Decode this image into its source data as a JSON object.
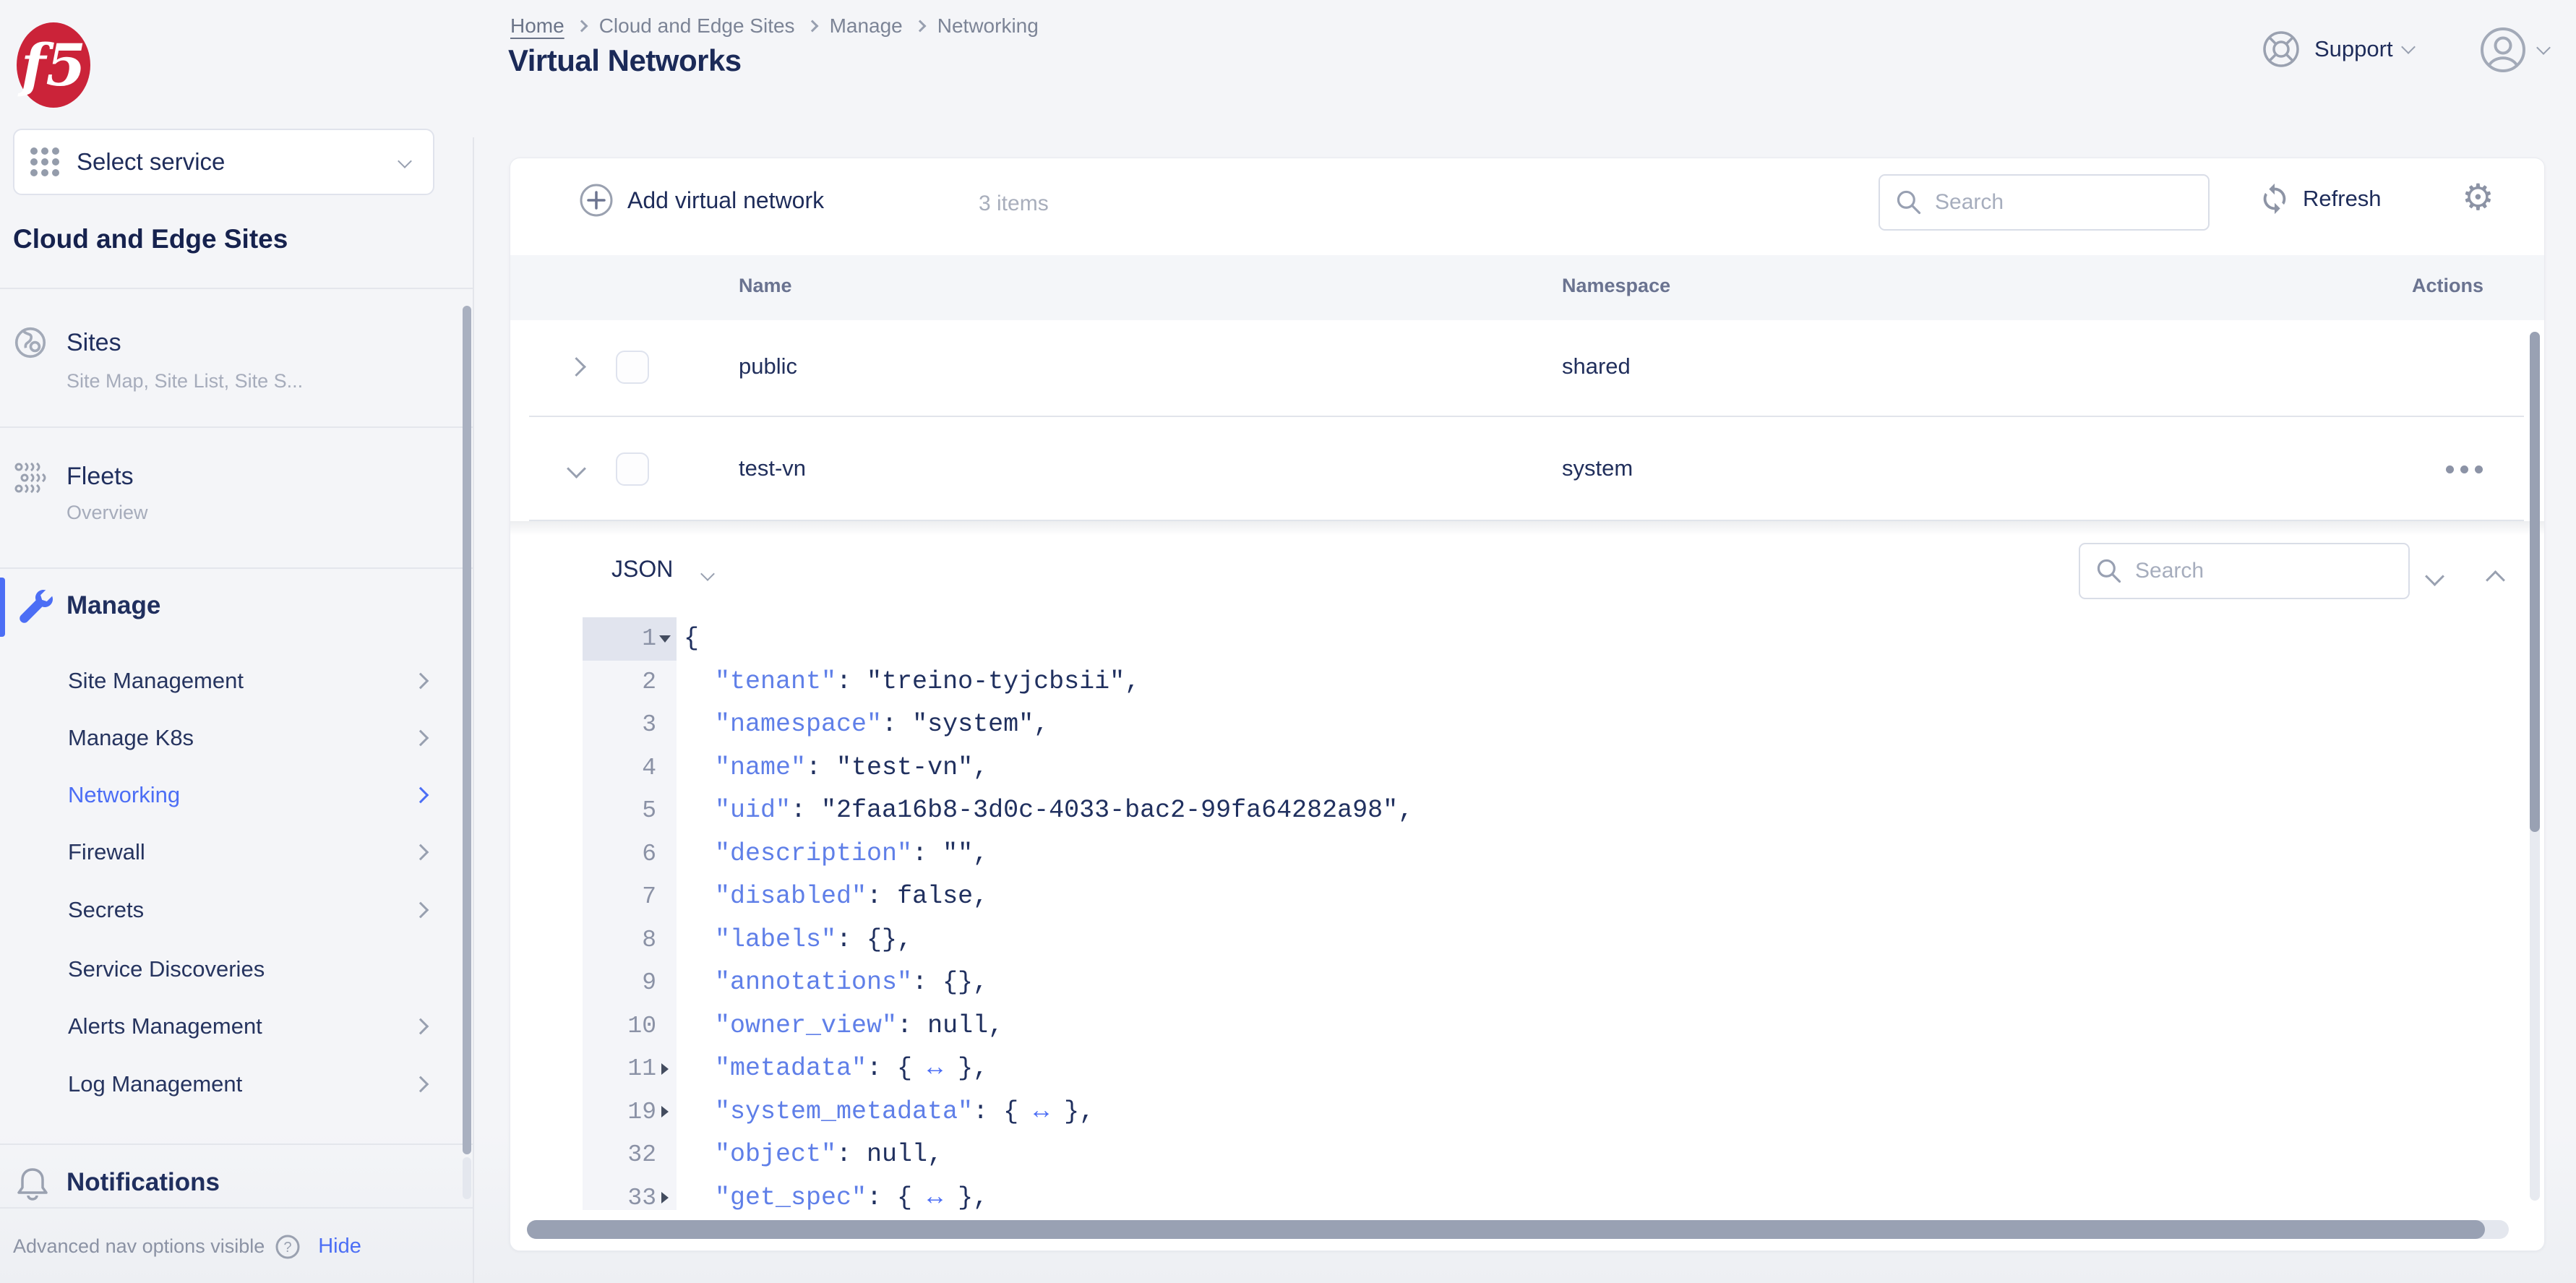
{
  "sidebar": {
    "logo_text": "f5",
    "select_service": "Select service",
    "heading": "Cloud and Edge Sites",
    "sites": {
      "title": "Sites",
      "subtitle": "Site Map, Site List, Site S..."
    },
    "fleets": {
      "title": "Fleets",
      "subtitle": "Overview"
    },
    "manage": {
      "title": "Manage",
      "items": [
        {
          "label": "Site Management",
          "chevron": true,
          "active": false
        },
        {
          "label": "Manage K8s",
          "chevron": true,
          "active": false
        },
        {
          "label": "Networking",
          "chevron": true,
          "active": true
        },
        {
          "label": "Firewall",
          "chevron": true,
          "active": false
        },
        {
          "label": "Secrets",
          "chevron": true,
          "active": false
        },
        {
          "label": "Service Discoveries",
          "chevron": false,
          "active": false
        },
        {
          "label": "Alerts Management",
          "chevron": true,
          "active": false
        },
        {
          "label": "Log Management",
          "chevron": true,
          "active": false
        }
      ]
    },
    "notifications": {
      "title": "Notifications"
    },
    "footer": {
      "text": "Advanced nav options visible",
      "action": "Hide"
    }
  },
  "header": {
    "breadcrumb": [
      {
        "label": "Home"
      },
      {
        "label": "Cloud and Edge Sites"
      },
      {
        "label": "Manage"
      },
      {
        "label": "Networking"
      }
    ],
    "title": "Virtual Networks",
    "support_label": "Support"
  },
  "toolbar": {
    "add_label": "Add virtual network",
    "items_count": "3 items",
    "search_placeholder": "Search",
    "refresh_label": "Refresh"
  },
  "table": {
    "columns": [
      "Name",
      "Namespace",
      "Actions"
    ],
    "rows": [
      {
        "name": "public",
        "namespace": "shared",
        "expanded": false,
        "has_actions": false
      },
      {
        "name": "test-vn",
        "namespace": "system",
        "expanded": true,
        "has_actions": true
      }
    ]
  },
  "json_viewer": {
    "mode": "JSON",
    "search_placeholder": "Search",
    "lines": [
      {
        "num": "1",
        "ind": 0,
        "fold": "open",
        "tokens": [
          {
            "t": "p",
            "v": "{"
          }
        ]
      },
      {
        "num": "2",
        "ind": 1,
        "fold": null,
        "tokens": [
          {
            "t": "k",
            "v": "\"tenant\""
          },
          {
            "t": "p",
            "v": ": "
          },
          {
            "t": "v",
            "v": "\"treino-tyjcbsii\""
          },
          {
            "t": "p",
            "v": ","
          }
        ]
      },
      {
        "num": "3",
        "ind": 1,
        "fold": null,
        "tokens": [
          {
            "t": "k",
            "v": "\"namespace\""
          },
          {
            "t": "p",
            "v": ": "
          },
          {
            "t": "v",
            "v": "\"system\""
          },
          {
            "t": "p",
            "v": ","
          }
        ]
      },
      {
        "num": "4",
        "ind": 1,
        "fold": null,
        "tokens": [
          {
            "t": "k",
            "v": "\"name\""
          },
          {
            "t": "p",
            "v": ": "
          },
          {
            "t": "v",
            "v": "\"test-vn\""
          },
          {
            "t": "p",
            "v": ","
          }
        ]
      },
      {
        "num": "5",
        "ind": 1,
        "fold": null,
        "tokens": [
          {
            "t": "k",
            "v": "\"uid\""
          },
          {
            "t": "p",
            "v": ": "
          },
          {
            "t": "v",
            "v": "\"2faa16b8-3d0c-4033-bac2-99fa64282a98\""
          },
          {
            "t": "p",
            "v": ","
          }
        ]
      },
      {
        "num": "6",
        "ind": 1,
        "fold": null,
        "tokens": [
          {
            "t": "k",
            "v": "\"description\""
          },
          {
            "t": "p",
            "v": ": "
          },
          {
            "t": "v",
            "v": "\"\""
          },
          {
            "t": "p",
            "v": ","
          }
        ]
      },
      {
        "num": "7",
        "ind": 1,
        "fold": null,
        "tokens": [
          {
            "t": "k",
            "v": "\"disabled\""
          },
          {
            "t": "p",
            "v": ": "
          },
          {
            "t": "v",
            "v": "false"
          },
          {
            "t": "p",
            "v": ","
          }
        ]
      },
      {
        "num": "8",
        "ind": 1,
        "fold": null,
        "tokens": [
          {
            "t": "k",
            "v": "\"labels\""
          },
          {
            "t": "p",
            "v": ": {},"
          }
        ]
      },
      {
        "num": "9",
        "ind": 1,
        "fold": null,
        "tokens": [
          {
            "t": "k",
            "v": "\"annotations\""
          },
          {
            "t": "p",
            "v": ": {},"
          }
        ]
      },
      {
        "num": "10",
        "ind": 1,
        "fold": null,
        "tokens": [
          {
            "t": "k",
            "v": "\"owner_view\""
          },
          {
            "t": "p",
            "v": ": "
          },
          {
            "t": "v",
            "v": "null"
          },
          {
            "t": "p",
            "v": ","
          }
        ]
      },
      {
        "num": "11",
        "ind": 1,
        "fold": "closed",
        "tokens": [
          {
            "t": "k",
            "v": "\"metadata\""
          },
          {
            "t": "p",
            "v": ": { "
          },
          {
            "t": "a",
            "v": "↔"
          },
          {
            "t": "p",
            "v": " },"
          }
        ]
      },
      {
        "num": "19",
        "ind": 1,
        "fold": "closed",
        "tokens": [
          {
            "t": "k",
            "v": "\"system_metadata\""
          },
          {
            "t": "p",
            "v": ": { "
          },
          {
            "t": "a",
            "v": "↔"
          },
          {
            "t": "p",
            "v": " },"
          }
        ]
      },
      {
        "num": "32",
        "ind": 1,
        "fold": null,
        "tokens": [
          {
            "t": "k",
            "v": "\"object\""
          },
          {
            "t": "p",
            "v": ": "
          },
          {
            "t": "v",
            "v": "null"
          },
          {
            "t": "p",
            "v": ","
          }
        ]
      },
      {
        "num": "33",
        "ind": 1,
        "fold": "closed",
        "tokens": [
          {
            "t": "k",
            "v": "\"get_spec\""
          },
          {
            "t": "p",
            "v": ": { "
          },
          {
            "t": "a",
            "v": "↔"
          },
          {
            "t": "p",
            "v": " },"
          }
        ]
      }
    ]
  },
  "colors": {
    "accent_blue": "#4c6ef5",
    "brand_red": "#cb2339",
    "navy": "#1e2c5a",
    "key_blue": "#5f7fe8"
  }
}
